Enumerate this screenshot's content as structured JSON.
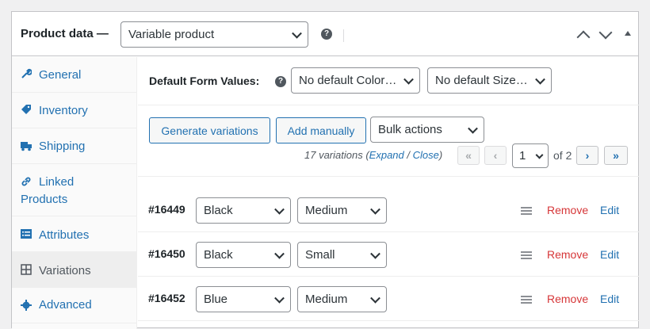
{
  "header": {
    "title": "Product data —",
    "product_type": "Variable product",
    "help_icon": "question-icon"
  },
  "sidebar": {
    "items": [
      {
        "label": "General",
        "icon": "wrench-icon"
      },
      {
        "label": "Inventory",
        "icon": "tag-icon"
      },
      {
        "label": "Shipping",
        "icon": "truck-icon"
      },
      {
        "label": "Linked",
        "label2": "Products",
        "icon": "link-icon"
      },
      {
        "label": "Attributes",
        "icon": "list-icon"
      },
      {
        "label": "Variations",
        "icon": "grid-icon",
        "active": true
      },
      {
        "label": "Advanced",
        "icon": "gear-icon"
      }
    ]
  },
  "defaults": {
    "label": "Default Form Values:",
    "color_select": "No default Color…",
    "size_select": "No default Size…"
  },
  "toolbar": {
    "generate_label": "Generate variations",
    "add_manually_label": "Add manually",
    "bulk_actions": "Bulk actions",
    "count_text": "17 variations",
    "expand": "Expand",
    "sep": "/",
    "close": "Close",
    "first": "«",
    "prev": "‹",
    "page": "1",
    "of_text": "of 2",
    "next": "›",
    "last": "»"
  },
  "variations": [
    {
      "id": "#16449",
      "color": "Black",
      "size": "Medium"
    },
    {
      "id": "#16450",
      "color": "Black",
      "size": "Small"
    },
    {
      "id": "#16452",
      "color": "Blue",
      "size": "Medium"
    }
  ],
  "row_actions": {
    "remove": "Remove",
    "edit": "Edit"
  },
  "colors": {
    "link": "#2271b1",
    "remove": "#d63638",
    "border": "#c3c4c7"
  }
}
